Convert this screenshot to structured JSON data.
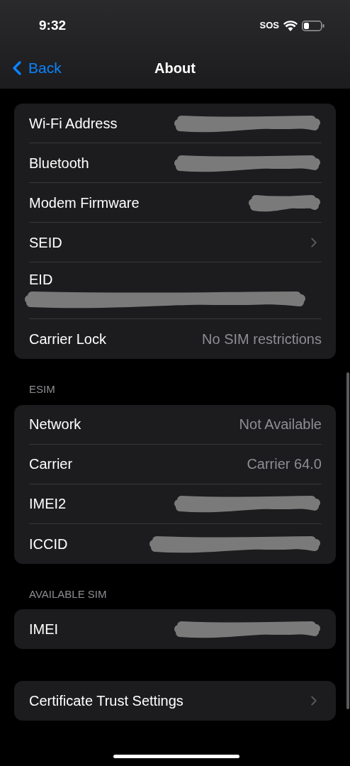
{
  "status_bar": {
    "time": "9:32",
    "sos": "SOS"
  },
  "nav": {
    "back": "Back",
    "title": "About"
  },
  "groups": [
    {
      "rows": [
        {
          "label": "Wi-Fi Address",
          "kind": "redacted"
        },
        {
          "label": "Bluetooth",
          "kind": "redacted"
        },
        {
          "label": "Modem Firmware",
          "kind": "redacted-short"
        },
        {
          "label": "SEID",
          "kind": "chevron"
        },
        {
          "label": "EID",
          "kind": "redacted-below"
        },
        {
          "label": "Carrier Lock",
          "kind": "value",
          "value": "No SIM restrictions"
        }
      ]
    },
    {
      "header": "ESIM",
      "rows": [
        {
          "label": "Network",
          "kind": "value",
          "value": "Not Available"
        },
        {
          "label": "Carrier",
          "kind": "value",
          "value": "Carrier 64.0"
        },
        {
          "label": "IMEI2",
          "kind": "redacted"
        },
        {
          "label": "ICCID",
          "kind": "redacted-long"
        }
      ]
    },
    {
      "header": "AVAILABLE SIM",
      "rows": [
        {
          "label": "IMEI",
          "kind": "redacted"
        }
      ]
    },
    {
      "rows": [
        {
          "label": "Certificate Trust Settings",
          "kind": "chevron"
        }
      ]
    }
  ]
}
